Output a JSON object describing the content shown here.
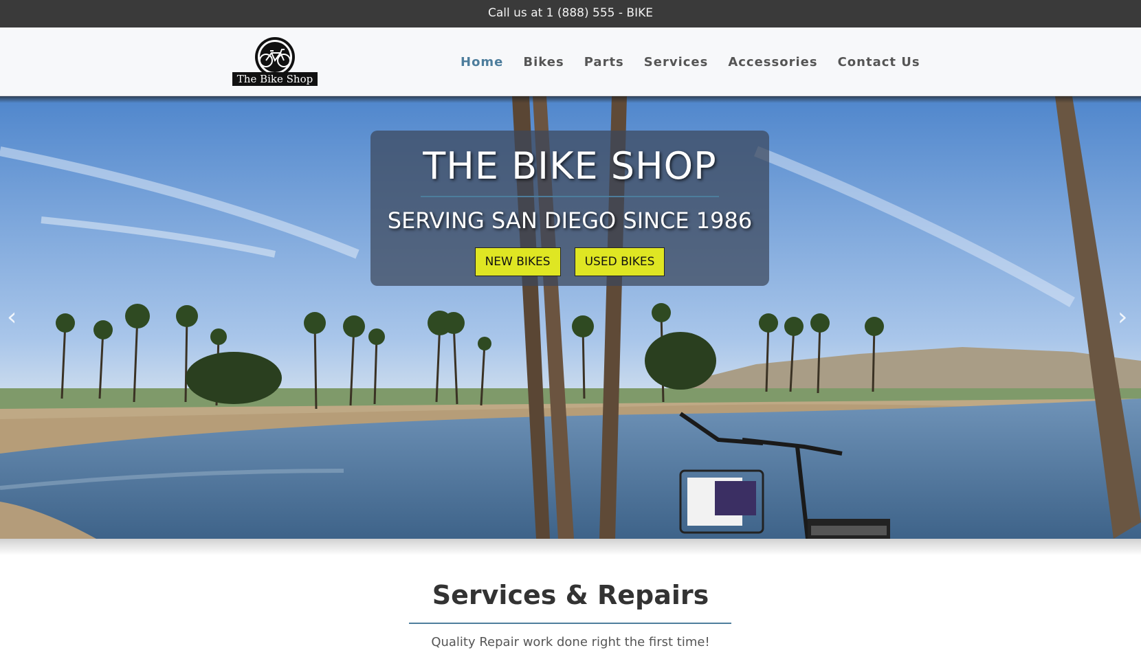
{
  "topbar": {
    "text": "Call us at 1 (888) 555 - BIKE"
  },
  "header": {
    "logo_text": "The Bike Shop",
    "nav": [
      {
        "label": "Home",
        "active": true
      },
      {
        "label": "Bikes",
        "active": false
      },
      {
        "label": "Parts",
        "active": false
      },
      {
        "label": "Services",
        "active": false
      },
      {
        "label": "Accessories",
        "active": false
      },
      {
        "label": "Contact Us",
        "active": false
      }
    ]
  },
  "hero": {
    "title": "THE BIKE SHOP",
    "subtitle": "SERVING SAN DIEGO SINCE 1986",
    "buttons": {
      "new": "NEW BIKES",
      "used": "USED BIKES"
    },
    "prev_icon": "‹",
    "next_icon": "›"
  },
  "section": {
    "title": "Services & Repairs",
    "subtitle": "Quality Repair work done right the first time!"
  },
  "colors": {
    "topbar": "#3a3a3a",
    "accent": "#4d7d9c",
    "button": "#dfe623",
    "nav_text": "#555555"
  }
}
